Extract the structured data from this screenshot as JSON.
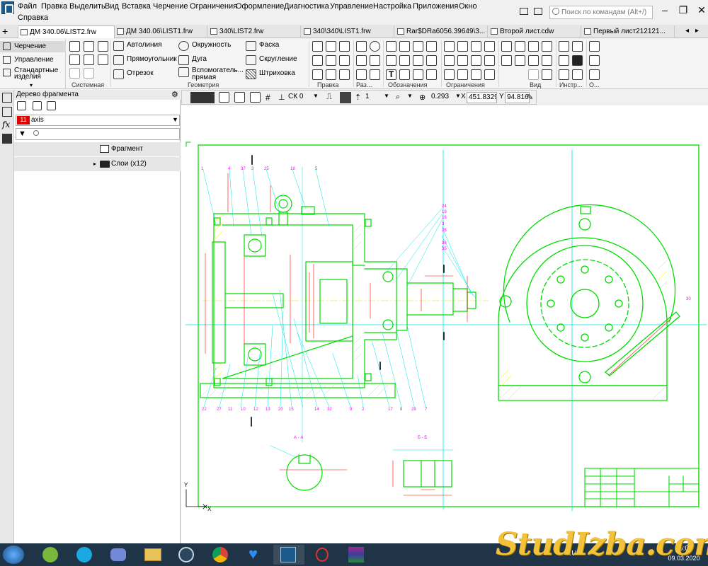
{
  "menu": [
    "Файл",
    "Правка",
    "Выделить",
    "Вид",
    "Вставка",
    "Черчение",
    "Ограничения",
    "Оформление",
    "Диагностика",
    "Управление",
    "Настройка",
    "Приложения",
    "Окно",
    "Справка"
  ],
  "search": {
    "placeholder": "Поиск по командам (Alt+/)"
  },
  "tabs": [
    {
      "label": "ДМ 340.06\\LIST2.frw",
      "active": true
    },
    {
      "label": "ДМ 340.06\\LIST1.frw"
    },
    {
      "label": "340\\LIST2.frw"
    },
    {
      "label": "340\\340\\LIST1.frw"
    },
    {
      "label": "Rar$DRa6056.39649\\3..."
    },
    {
      "label": "Второй лист.cdw"
    },
    {
      "label": "Первый лист212121..."
    }
  ],
  "modes": [
    "Черчение",
    "Управление",
    "Стандартные изделия"
  ],
  "ribbon": {
    "system_label": "Системная",
    "geometry_cmds": [
      "Автолиния",
      "Окружность",
      "Фаска",
      "Прямоугольник",
      "Дуга",
      "Скругление",
      "Отрезок",
      "Вспомогатель... прямая",
      "Штриховка"
    ],
    "groups": [
      "Геометрия",
      "Правка",
      "Раз...",
      "Обозначения",
      "Ограничения",
      "Вид",
      "Инстр...",
      "О..."
    ]
  },
  "tree": {
    "title": "Дерево фрагмента",
    "layer_num": "11",
    "layer_name": "axis",
    "items": [
      "Фрагмент",
      "Слои (x12)"
    ]
  },
  "canvas_toolbar": {
    "cs": "СК 0",
    "step": "1",
    "zoom": "0.293",
    "x_label": "X",
    "x_value": "451.8329",
    "y_label": "Y",
    "y_value": "94.8163"
  },
  "drawing": {
    "section_aa": "А - А",
    "section_bb": "Б - Б",
    "axis_y": "Y",
    "axis_x": "X",
    "balloons_left_bottom": [
      "22",
      "27",
      "11",
      "10",
      "12",
      "13",
      "20",
      "15",
      "14",
      "32",
      "9",
      "2",
      "17",
      "8",
      "28",
      "7"
    ],
    "balloons_top": [
      "1",
      "4",
      "37",
      "3",
      "25",
      "18",
      "5"
    ],
    "balloons_right": [
      "24",
      "19",
      "16",
      "3",
      "25",
      "36",
      "35",
      "30"
    ]
  },
  "taskbar": {
    "time": "16:06",
    "date": "09.03.2020",
    "lang": "RU"
  },
  "watermark": "StudIzba.com",
  "colors": {
    "drawing_green": "#00dd00",
    "axis_cyan": "#00e5e5",
    "dim_red": "#ff0000",
    "leader_magenta": "#ff00ff",
    "hatch_yellow": "#e6e600"
  }
}
